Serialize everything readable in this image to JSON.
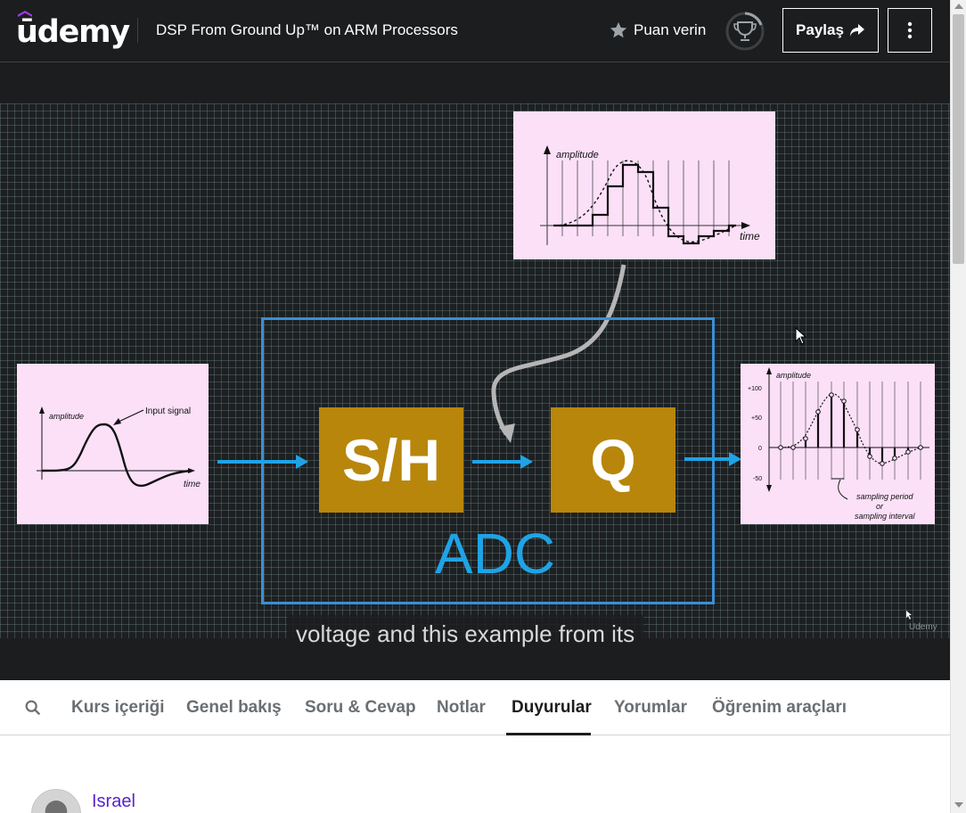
{
  "app": {
    "logo_text": "ūdemy",
    "accent": "#a435f0"
  },
  "header": {
    "course_title": "DSP From Ground Up™ on ARM Processors",
    "rate_label": "Puan verin",
    "rate_icon": "star-icon",
    "progress_icon": "trophy-icon",
    "share_label": "Paylaş",
    "share_icon": "share-arrow-icon",
    "more_icon": "vertical-ellipsis-icon"
  },
  "video": {
    "caption": "voltage and this example from its",
    "watermark": "Udemy",
    "slide": {
      "block_sh": "S/H",
      "block_q": "Q",
      "adc_label": "ADC",
      "input_panel": {
        "ylabel": "amplitude",
        "xlabel": "time",
        "annotation": "Input signal"
      },
      "quant_panel": {
        "ylabel": "amplitude",
        "xlabel": "time"
      },
      "sample_panel": {
        "ylabel": "amplitude",
        "ticks": [
          "+100",
          "+50",
          "0",
          "-50"
        ],
        "annotation_lines": [
          "sampling period",
          "or",
          "sampling interval"
        ]
      }
    },
    "colors": {
      "block": "#b8860b",
      "adc_border": "#3a8fd6",
      "arrow": "#1fa3e6"
    }
  },
  "tabs": {
    "search_icon": "search-icon",
    "items": [
      {
        "label": "Kurs içeriği"
      },
      {
        "label": "Genel bakış"
      },
      {
        "label": "Soru & Cevap"
      },
      {
        "label": "Notlar"
      },
      {
        "label": "Duyurular",
        "active": true
      },
      {
        "label": "Yorumlar"
      },
      {
        "label": "Öğrenim araçları"
      }
    ]
  },
  "announcement": {
    "author": "Israel",
    "author_color": "#5624d0"
  }
}
